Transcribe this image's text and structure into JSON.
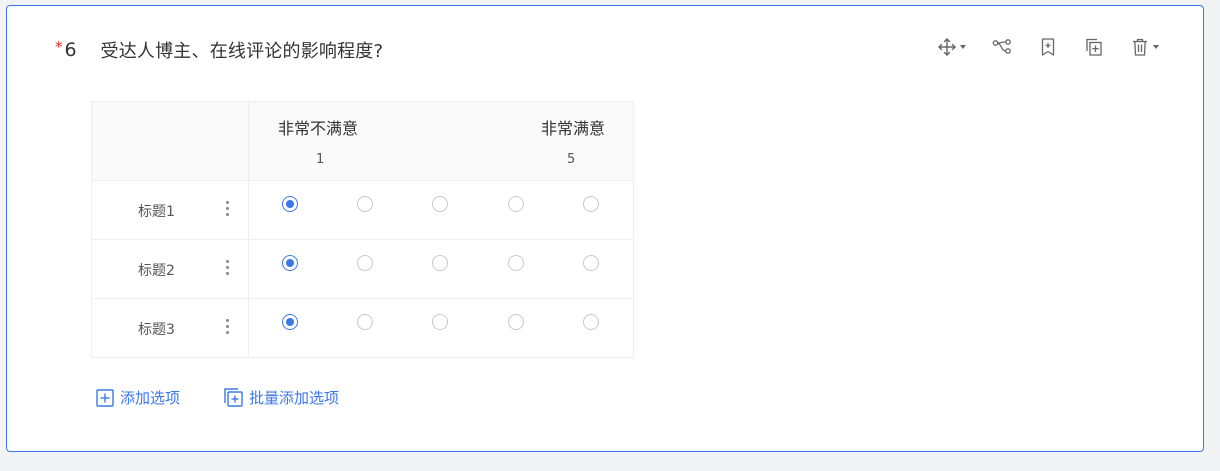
{
  "question": {
    "required_mark": "*",
    "number": "6",
    "title": "受达人博主、在线评论的影响程度?"
  },
  "toolbar": {
    "icons": [
      "move-icon",
      "logic-icon",
      "bookmark-add-icon",
      "copy-icon",
      "delete-icon"
    ]
  },
  "matrix": {
    "scale_left_label": "非常不满意",
    "scale_right_label": "非常满意",
    "scale_min": "1",
    "scale_max": "5",
    "rows": [
      {
        "label": "标题1",
        "selected": 1
      },
      {
        "label": "标题2",
        "selected": 1
      },
      {
        "label": "标题3",
        "selected": 1
      }
    ],
    "options_count": 5
  },
  "actions": {
    "add_option": "添加选项",
    "batch_add_option": "批量添加选项"
  },
  "colors": {
    "accent": "#3b78e7",
    "required": "#f5222d",
    "border": "#eeeeee"
  }
}
